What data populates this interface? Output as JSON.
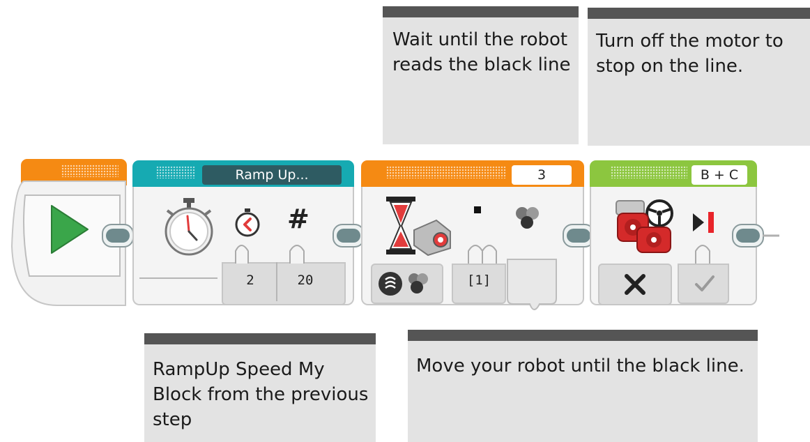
{
  "comments": {
    "wait": "Wait until the robot reads the black line",
    "turnoff": "Turn off the motor to stop on the line.",
    "rampup": "RampUp Speed My Block from the previous step",
    "move": "Move your robot until the black line."
  },
  "blocks": {
    "start": {
      "icon": "play-icon"
    },
    "rampup": {
      "label": "Ramp Up...",
      "param1": "2",
      "param2": "20",
      "icons": [
        "stopwatch-icon",
        "timer-icon",
        "hash-icon"
      ]
    },
    "wait": {
      "port": "3",
      "mode_value": "[1]",
      "icons": [
        "hourglass-icon",
        "color-sensor-icon",
        "color-dots-icon"
      ]
    },
    "motor": {
      "ports": "B + C",
      "icons": [
        "steering-motor-icon",
        "play-stop-icon",
        "close-icon",
        "checkmark-icon"
      ]
    }
  },
  "colors": {
    "start_header": "#f58a13",
    "rampup_header": "#16aab2",
    "wait_header": "#f58a13",
    "motor_header": "#8cc63f",
    "comment_bg": "#e3e3e3",
    "comment_bar": "#555555"
  }
}
